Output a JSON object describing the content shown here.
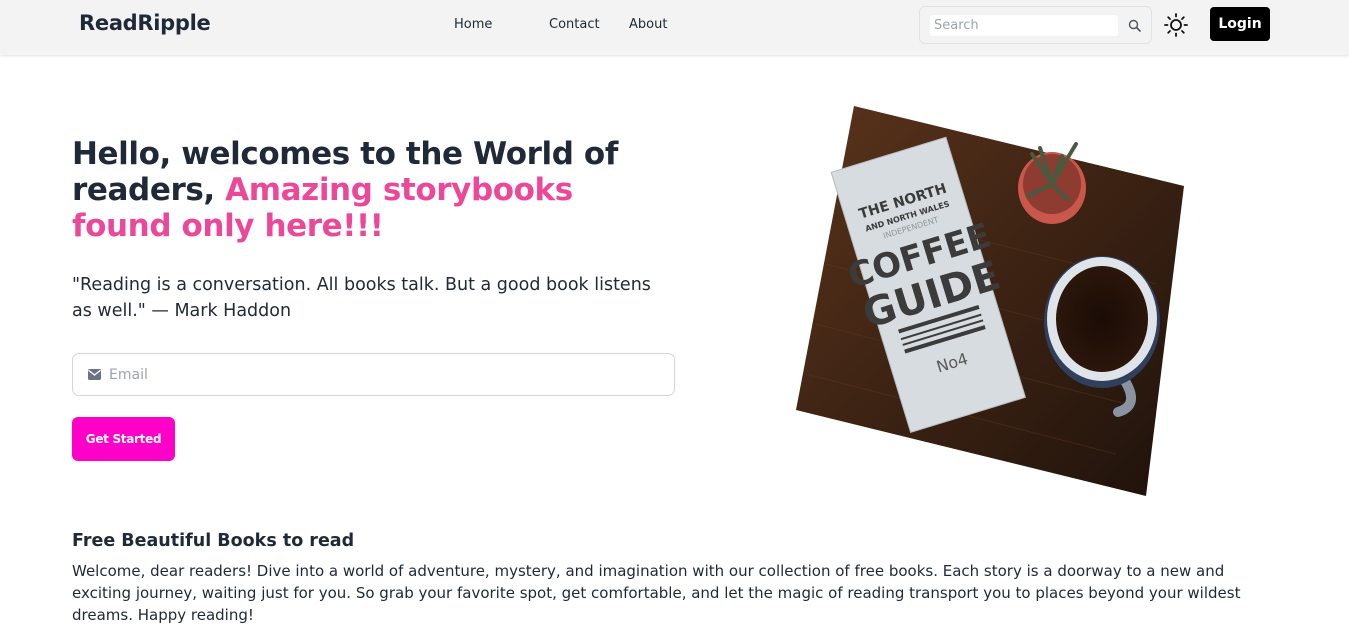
{
  "navbar": {
    "brand": "ReadRipple",
    "links": [
      "Home",
      "Contact",
      "About"
    ],
    "search_placeholder": "Search",
    "login_label": "Login"
  },
  "hero": {
    "title_plain": "Hello, welcomes to the World of readers,",
    "title_accent": "Amazing storybooks found only here!!!",
    "quote": "\"Reading is a conversation. All books talk. But a good book listens as well.\" — Mark Haddon",
    "email_placeholder": "Email",
    "cta_label": "Get Started",
    "image": {
      "book_lines": [
        "THE NORTH",
        "AND NORTH WALES",
        "INDEPENDENT",
        "COFFEE",
        "GUIDE",
        "No4"
      ]
    }
  },
  "section": {
    "title": "Free Beautiful Books to read",
    "text": "Welcome, dear readers! Dive into a world of adventure, mystery, and imagination with our collection of free books. Each story is a doorway to a new and exciting journey, waiting just for you. So grab your favorite spot, get comfortable, and let the magic of reading transport you to places beyond your wildest dreams. Happy reading!"
  },
  "colors": {
    "accent": "#ec4899",
    "cta": "#ff00c8",
    "login": "#000000",
    "navbar_bg": "#f3f3f3",
    "text": "#1f2937"
  },
  "icons": {
    "search": "search-icon",
    "theme": "sun-icon",
    "email": "envelope-icon"
  }
}
